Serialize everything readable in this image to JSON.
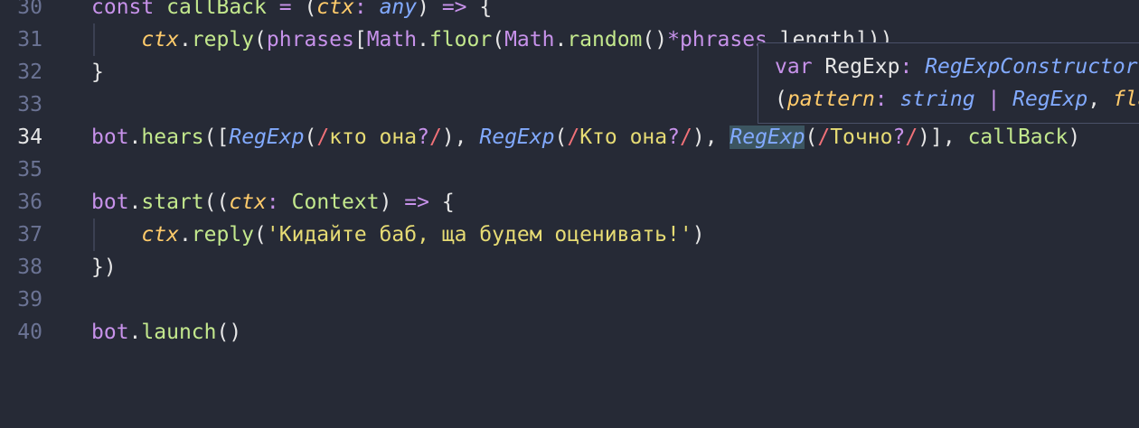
{
  "editor": {
    "lines": [
      {
        "num": "30",
        "tokens": [
          {
            "t": "const ",
            "c": "k"
          },
          {
            "t": "callBack",
            "c": "fn"
          },
          {
            "t": " ",
            "c": "p"
          },
          {
            "t": "=",
            "c": "op"
          },
          {
            "t": " (",
            "c": "p"
          },
          {
            "t": "ctx",
            "c": "it"
          },
          {
            "t": ":",
            "c": "op"
          },
          {
            "t": " ",
            "c": "p"
          },
          {
            "t": "any",
            "c": "ty"
          },
          {
            "t": ") ",
            "c": "p"
          },
          {
            "t": "=>",
            "c": "op"
          },
          {
            "t": " {",
            "c": "p"
          }
        ]
      },
      {
        "num": "31",
        "tokens": [
          {
            "t": "    ",
            "c": "p"
          },
          {
            "t": "ctx",
            "c": "it"
          },
          {
            "t": ".",
            "c": "p"
          },
          {
            "t": "reply",
            "c": "fn"
          },
          {
            "t": "(",
            "c": "p"
          },
          {
            "t": "phrases",
            "c": "k"
          },
          {
            "t": "[",
            "c": "p"
          },
          {
            "t": "Math",
            "c": "k"
          },
          {
            "t": ".",
            "c": "p"
          },
          {
            "t": "floor",
            "c": "fn"
          },
          {
            "t": "(",
            "c": "p"
          },
          {
            "t": "Math",
            "c": "k"
          },
          {
            "t": ".",
            "c": "p"
          },
          {
            "t": "random",
            "c": "fn"
          },
          {
            "t": "()",
            "c": "p"
          },
          {
            "t": "*",
            "c": "op"
          },
          {
            "t": "phrases",
            "c": "k"
          },
          {
            "t": ".",
            "c": "p"
          },
          {
            "t": "length",
            "c": "p"
          },
          {
            "t": "])",
            "c": "p"
          },
          {
            "t": ")",
            "c": "p"
          }
        ]
      },
      {
        "num": "32",
        "tokens": [
          {
            "t": "}",
            "c": "p"
          }
        ]
      },
      {
        "num": "33",
        "tokens": []
      },
      {
        "num": "34",
        "tokens": [
          {
            "t": "bot",
            "c": "k"
          },
          {
            "t": ".",
            "c": "p"
          },
          {
            "t": "hears",
            "c": "fn"
          },
          {
            "t": "([",
            "c": "p"
          },
          {
            "t": "RegExp",
            "c": "ty"
          },
          {
            "t": "(",
            "c": "p"
          },
          {
            "t": "/",
            "c": "rg"
          },
          {
            "t": "кто она",
            "c": "st"
          },
          {
            "t": "?",
            "c": "op"
          },
          {
            "t": "/",
            "c": "rg"
          },
          {
            "t": "), ",
            "c": "p"
          },
          {
            "t": "RegExp",
            "c": "ty"
          },
          {
            "t": "(",
            "c": "p"
          },
          {
            "t": "/",
            "c": "rg"
          },
          {
            "t": "Кто она",
            "c": "st"
          },
          {
            "t": "?",
            "c": "op"
          },
          {
            "t": "/",
            "c": "rg"
          },
          {
            "t": "), ",
            "c": "p"
          },
          {
            "t": "RegExp",
            "c": "ty hl"
          },
          {
            "t": "(",
            "c": "p"
          },
          {
            "t": "/",
            "c": "rg"
          },
          {
            "t": "Точно",
            "c": "st"
          },
          {
            "t": "?",
            "c": "op"
          },
          {
            "t": "/",
            "c": "rg"
          },
          {
            "t": ")], ",
            "c": "p"
          },
          {
            "t": "callBack",
            "c": "fn"
          },
          {
            "t": ")",
            "c": "p"
          }
        ]
      },
      {
        "num": "35",
        "tokens": []
      },
      {
        "num": "36",
        "tokens": [
          {
            "t": "bot",
            "c": "k"
          },
          {
            "t": ".",
            "c": "p"
          },
          {
            "t": "start",
            "c": "fn"
          },
          {
            "t": "((",
            "c": "p"
          },
          {
            "t": "ctx",
            "c": "it"
          },
          {
            "t": ":",
            "c": "op"
          },
          {
            "t": " ",
            "c": "p"
          },
          {
            "t": "Context",
            "c": "gr"
          },
          {
            "t": ") ",
            "c": "p"
          },
          {
            "t": "=>",
            "c": "op"
          },
          {
            "t": " {",
            "c": "p"
          }
        ]
      },
      {
        "num": "37",
        "tokens": [
          {
            "t": "    ",
            "c": "p"
          },
          {
            "t": "ctx",
            "c": "it"
          },
          {
            "t": ".",
            "c": "p"
          },
          {
            "t": "reply",
            "c": "fn"
          },
          {
            "t": "(",
            "c": "p"
          },
          {
            "t": "'Кидайте баб, ща будем оценивать!'",
            "c": "st"
          },
          {
            "t": ")",
            "c": "p"
          }
        ]
      },
      {
        "num": "38",
        "tokens": [
          {
            "t": "})",
            "c": "p"
          }
        ]
      },
      {
        "num": "39",
        "tokens": []
      },
      {
        "num": "40",
        "tokens": [
          {
            "t": "bot",
            "c": "k"
          },
          {
            "t": ".",
            "c": "p"
          },
          {
            "t": "launch",
            "c": "fn"
          },
          {
            "t": "()",
            "c": "p"
          }
        ]
      }
    ],
    "active_line": "34"
  },
  "tooltip": {
    "line1_tokens": [
      {
        "t": "var ",
        "c": "k"
      },
      {
        "t": "RegExp",
        "c": "p"
      },
      {
        "t": ": ",
        "c": "op"
      },
      {
        "t": "RegExpConstructor",
        "c": "ty"
      }
    ],
    "line2_tokens": [
      {
        "t": "(",
        "c": "p"
      },
      {
        "t": "pattern",
        "c": "it"
      },
      {
        "t": ": ",
        "c": "op"
      },
      {
        "t": "string",
        "c": "ty"
      },
      {
        "t": " | ",
        "c": "op"
      },
      {
        "t": "RegExp",
        "c": "ty"
      },
      {
        "t": ", ",
        "c": "p"
      },
      {
        "t": "flags",
        "c": "it"
      }
    ]
  }
}
